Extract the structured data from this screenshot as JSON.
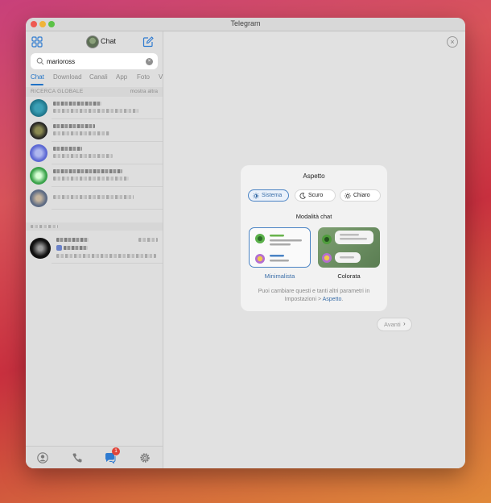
{
  "window": {
    "title": "Telegram"
  },
  "sidebar": {
    "title": "Chat",
    "search": {
      "value": "marioross",
      "placeholder": ""
    },
    "tabs": [
      "Chat",
      "Download",
      "Canali",
      "App",
      "Foto",
      "V"
    ],
    "active_tab": "Chat",
    "section": {
      "title": "RICERCA GLOBALE",
      "action": "mostra altra"
    },
    "badge_count": "1",
    "bottom_icons": [
      "profile-icon",
      "phone-icon",
      "chats-icon",
      "settings-icon"
    ]
  },
  "main": {
    "close_symbol": "×",
    "card": {
      "title": "Aspetto",
      "themes": [
        {
          "label": "Sistema",
          "icon": "sun-half-icon",
          "selected": true
        },
        {
          "label": "Scuro",
          "icon": "moon-icon",
          "selected": false
        },
        {
          "label": "Chiaro",
          "icon": "sun-icon",
          "selected": false
        }
      ],
      "chat_mode_title": "Modalità chat",
      "options": [
        {
          "label": "Minimalista",
          "selected": true
        },
        {
          "label": "Colorata",
          "selected": false
        }
      ],
      "note": "Puoi cambiare questi e tanti altri parametri in Impostazioni > ",
      "note_link": "Aspetto",
      "note_end": "."
    },
    "next_button": "Avanti",
    "next_symbol": "›"
  },
  "colors": {
    "accent": "#3a6ea8",
    "badge": "#e0453a"
  }
}
